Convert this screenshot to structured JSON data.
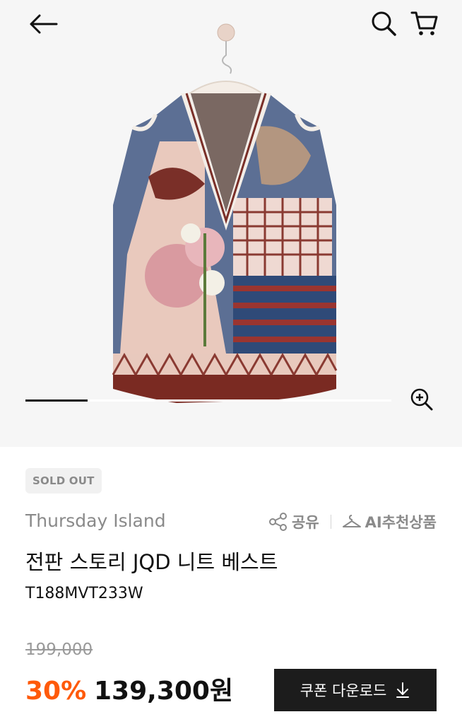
{
  "status_badge": "SOLD OUT",
  "product": {
    "brand": "Thursday Island",
    "name": "전판 스토리 JQD 니트 베스트",
    "code": "T188MVT233W"
  },
  "actions": {
    "share_label": "공유",
    "ai_recommend_label": "AI추천상품"
  },
  "pricing": {
    "original_price": "199,000",
    "discount_rate": "30%",
    "sale_price": "139,300원"
  },
  "coupon_button": {
    "label": "쿠폰 다운로드"
  },
  "carousel": {
    "progress": 0.17
  },
  "icons": {
    "back": "arrow-left-icon",
    "search": "search-icon",
    "cart": "cart-icon",
    "zoom": "zoom-in-icon",
    "share": "share-icon",
    "ai": "hanger-icon",
    "download": "download-arrow-icon"
  },
  "colors": {
    "accent_discount": "#ff5a0a",
    "button_bg": "#1c1c1c",
    "muted_text": "#8a8a8a"
  }
}
